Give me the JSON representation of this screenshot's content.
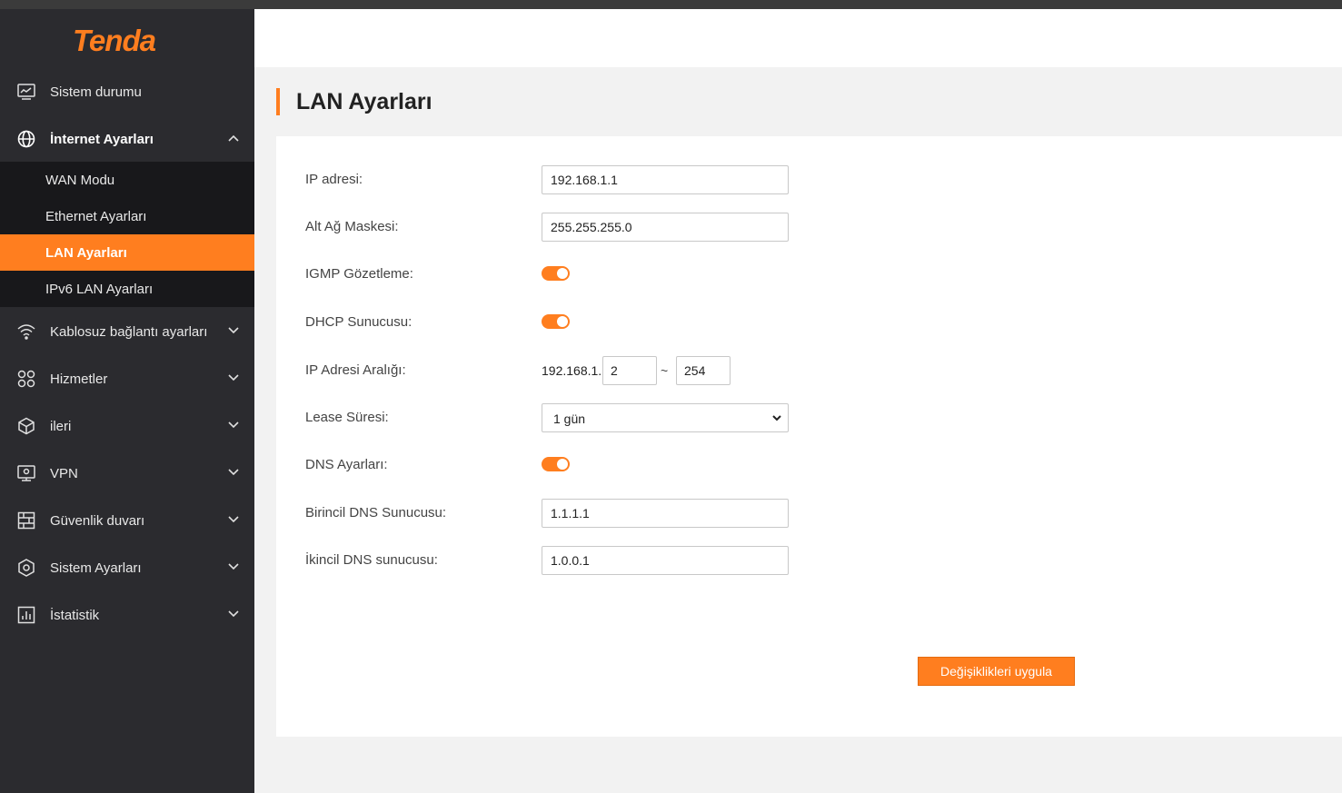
{
  "brand": {
    "logo_text": "Tenda",
    "accent_color": "#ff7e1f"
  },
  "sidebar": {
    "items": [
      {
        "label": "Sistem durumu",
        "icon": "monitor-icon"
      },
      {
        "label": "İnternet Ayarları",
        "icon": "globe-icon",
        "expanded": true
      },
      {
        "label": "Kablosuz bağlantı ayarları",
        "icon": "wifi-icon"
      },
      {
        "label": "Hizmetler",
        "icon": "apps-grid-icon"
      },
      {
        "label": "ileri",
        "icon": "cube-icon"
      },
      {
        "label": "VPN",
        "icon": "vpn-monitor-icon"
      },
      {
        "label": "Güvenlik duvarı",
        "icon": "firewall-icon"
      },
      {
        "label": "Sistem Ayarları",
        "icon": "hexagon-settings-icon"
      },
      {
        "label": "İstatistik",
        "icon": "statistics-icon"
      }
    ],
    "submenu": [
      {
        "label": "WAN Modu"
      },
      {
        "label": "Ethernet Ayarları"
      },
      {
        "label": "LAN Ayarları",
        "active": true
      },
      {
        "label": "IPv6 LAN Ayarları"
      }
    ]
  },
  "page": {
    "title": "LAN Ayarları"
  },
  "form": {
    "ip_address": {
      "label": "IP adresi:",
      "value": "192.168.1.1"
    },
    "subnet_mask": {
      "label": "Alt Ağ Maskesi:",
      "value": "255.255.255.0"
    },
    "igmp": {
      "label": "IGMP Gözetleme:",
      "enabled": true
    },
    "dhcp": {
      "label": "DHCP Sunucusu:",
      "enabled": true
    },
    "ip_range": {
      "label": "IP Adresi Aralığı:",
      "prefix": "192.168.1.",
      "start": "2",
      "separator": "~",
      "end": "254"
    },
    "lease": {
      "label": "Lease Süresi:",
      "value": "1 gün"
    },
    "dns": {
      "label": "DNS Ayarları:",
      "enabled": true
    },
    "primary_dns": {
      "label": "Birincil DNS Sunucusu:",
      "value": "1.1.1.1"
    },
    "secondary_dns": {
      "label": "İkincil DNS sunucusu:",
      "value": "1.0.0.1"
    },
    "apply_label": "Değişiklikleri uygula"
  }
}
